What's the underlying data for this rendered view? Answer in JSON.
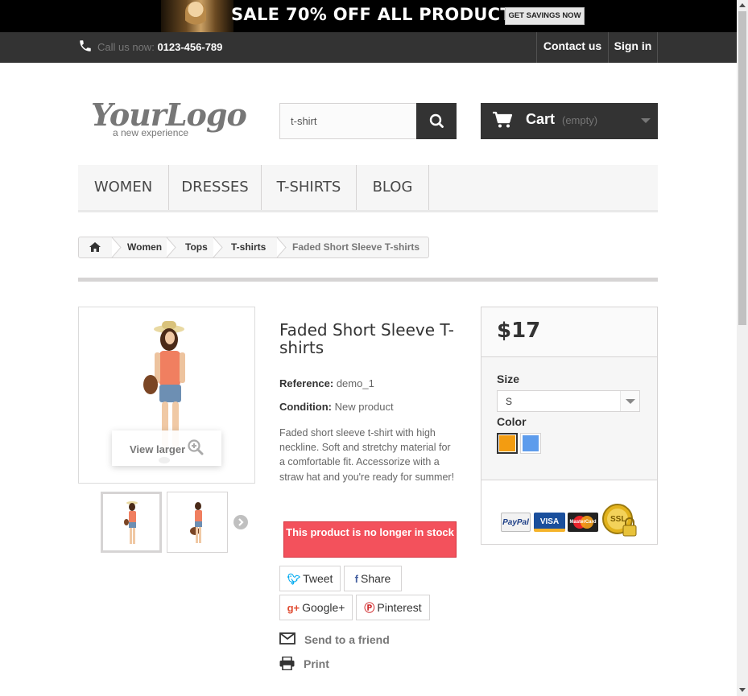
{
  "banner": {
    "sale_text": "SALE 70% OFF ALL PRODUCTS",
    "cta_label": "GET SAVINGS NOW"
  },
  "topnav": {
    "call_label": "Call us now:",
    "phone": "0123-456-789",
    "contact_label": "Contact us",
    "signin_label": "Sign in"
  },
  "logo": {
    "word": "YourLogo",
    "tagline": "a new experience"
  },
  "search": {
    "value": "t-shirt"
  },
  "cart": {
    "label": "Cart",
    "status": "(empty)"
  },
  "menu": {
    "items": [
      "WOMEN",
      "DRESSES",
      "T-SHIRTS",
      "BLOG"
    ]
  },
  "breadcrumb": {
    "items": [
      "Women",
      "Tops",
      "T-shirts"
    ],
    "current": "Faded Short Sleeve T-shirts"
  },
  "product": {
    "title": "Faded Short Sleeve T-shirts",
    "view_larger": "View larger",
    "reference_label": "Reference:",
    "reference": "demo_1",
    "condition_label": "Condition:",
    "condition": "New product",
    "description": "Faded short sleeve t-shirt with high neckline. Soft and stretchy material for a comfortable fit. Accessorize with a straw hat and you're ready for summer!",
    "stock_message": "This product is no longer in stock",
    "share": {
      "tweet": "Tweet",
      "share": "Share",
      "google": "Google+",
      "pinterest": "Pinterest"
    },
    "send_friend": "Send to a friend",
    "print": "Print"
  },
  "buybox": {
    "price": "$17",
    "size_label": "Size",
    "size_value": "S",
    "color_label": "Color",
    "colors": [
      "#f39c11",
      "#5d9cec"
    ],
    "cards": [
      "PayPal",
      "VISA",
      "MasterCard",
      "SSL"
    ]
  }
}
